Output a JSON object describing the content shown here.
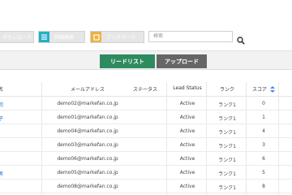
{
  "toolbar": {
    "download_label": "ダウンロード",
    "detail_search_label": "詳細検索",
    "bookmark_label": "ブックマーク",
    "search_placeholder": "検索"
  },
  "tabs": [
    {
      "label": "リードリスト",
      "active": true,
      "color": "#2e8b5f"
    },
    {
      "label": "アップロード",
      "active": false,
      "color": "#666666"
    }
  ],
  "table": {
    "headers": {
      "name": "名",
      "email": "メールアドレス",
      "status": "ステータス",
      "lead_status": "Lead Status",
      "rank": "ランク",
      "score": "スコア"
    },
    "rows": [
      {
        "name": "司",
        "email": "demo02@markefan.co.jp",
        "status": "",
        "lead_status": "Active",
        "rank": "ランク1",
        "score": "0"
      },
      {
        "name": "子",
        "email": "demo01@markefan.co.jp",
        "status": "",
        "lead_status": "Active",
        "rank": "ランク1",
        "score": "1"
      },
      {
        "name": "",
        "email": "demo04@markefan.co.jp",
        "status": "",
        "lead_status": "Active",
        "rank": "ランク1",
        "score": "4"
      },
      {
        "name": "",
        "email": "demo03@markefan.co.jp",
        "status": "",
        "lead_status": "Active",
        "rank": "ランク1",
        "score": "3"
      },
      {
        "name": "",
        "email": "demo06@markefan.co.jp",
        "status": "",
        "lead_status": "Active",
        "rank": "ランク1",
        "score": "6"
      },
      {
        "name": "男",
        "email": "demo05@markefan.co.jp",
        "status": "",
        "lead_status": "Active",
        "rank": "ランク1",
        "score": "5"
      },
      {
        "name": "",
        "email": "demo08@markefan.co.jp",
        "status": "",
        "lead_status": "Active",
        "rank": "ランク1",
        "score": "8"
      }
    ]
  },
  "colors": {
    "accent_green": "#2e8b5f",
    "link_blue": "#1e6fd0",
    "sort_blue": "#4a86e8",
    "detail_icon": "#26b0c6",
    "bookmark_icon": "#f0b040"
  }
}
